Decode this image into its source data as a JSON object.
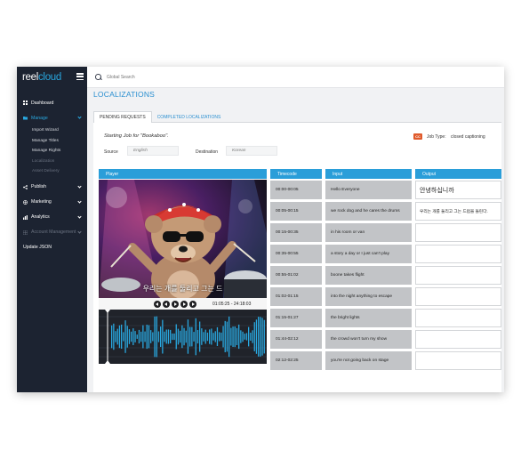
{
  "sidebar": {
    "logo_part1": "reel",
    "logo_part2": "cloud",
    "items": [
      {
        "label": "Dashboard"
      },
      {
        "label": "Manage"
      },
      {
        "label": "Publish"
      },
      {
        "label": "Marketing"
      },
      {
        "label": "Analytics"
      },
      {
        "label": "Account Management"
      },
      {
        "label": "Update JSON"
      }
    ],
    "manage_sub": [
      "Import Wizard",
      "Manage Titles",
      "Manage Rights",
      "Localization",
      "Asset Delivery"
    ]
  },
  "search": {
    "placeholder": "Global Search"
  },
  "page": {
    "title": "LOCALIZATIONS"
  },
  "tabs": [
    {
      "label": "PENDING REQUESTS"
    },
    {
      "label": "COMPLETED LOCALIZATIONS"
    }
  ],
  "job": {
    "title": "Starting Job for \"Bookaboo\".",
    "source_label": "Source",
    "source_value": "English",
    "destination_label": "Destination",
    "destination_value": "Korean",
    "cc_badge": "CC",
    "job_type_label": "Job Type:",
    "job_type_value": "closed captioning"
  },
  "columns": {
    "player": "Player",
    "timecode": "Timecode",
    "input": "Input",
    "output": "Output"
  },
  "player": {
    "subtitle": "우리는 개를 둘리고 그는 드",
    "timecode": "01:05:25 - 24:18:03"
  },
  "rows": [
    {
      "timecode": "00:00-00:05",
      "input": "Hello Everyone",
      "output": "안녕하십니까"
    },
    {
      "timecode": "00:05-00:15",
      "input": "we rock dog and he cares the drums",
      "output": "우리는 개를 둘리고 그는 드럼을 돌린다."
    },
    {
      "timecode": "00:15-00:35",
      "input": "in his room or van",
      "output": ""
    },
    {
      "timecode": "00:35-00:55",
      "input": "a story a day or I just can't play",
      "output": ""
    },
    {
      "timecode": "00:55-01:02",
      "input": "boone takes flight",
      "output": ""
    },
    {
      "timecode": "01:02-01:15",
      "input": "into the night anything to escape",
      "output": ""
    },
    {
      "timecode": "01:15-01:27",
      "input": "the bright lights",
      "output": ""
    },
    {
      "timecode": "01:44-02:12",
      "input": "the crowd won't turn my show",
      "output": ""
    },
    {
      "timecode": "02:12-02:25",
      "input": "you're not going back on stage",
      "output": ""
    }
  ],
  "colors": {
    "accent": "#2a9ed9",
    "sidebar": "#1c2331",
    "cc_badge": "#e05a2b"
  }
}
